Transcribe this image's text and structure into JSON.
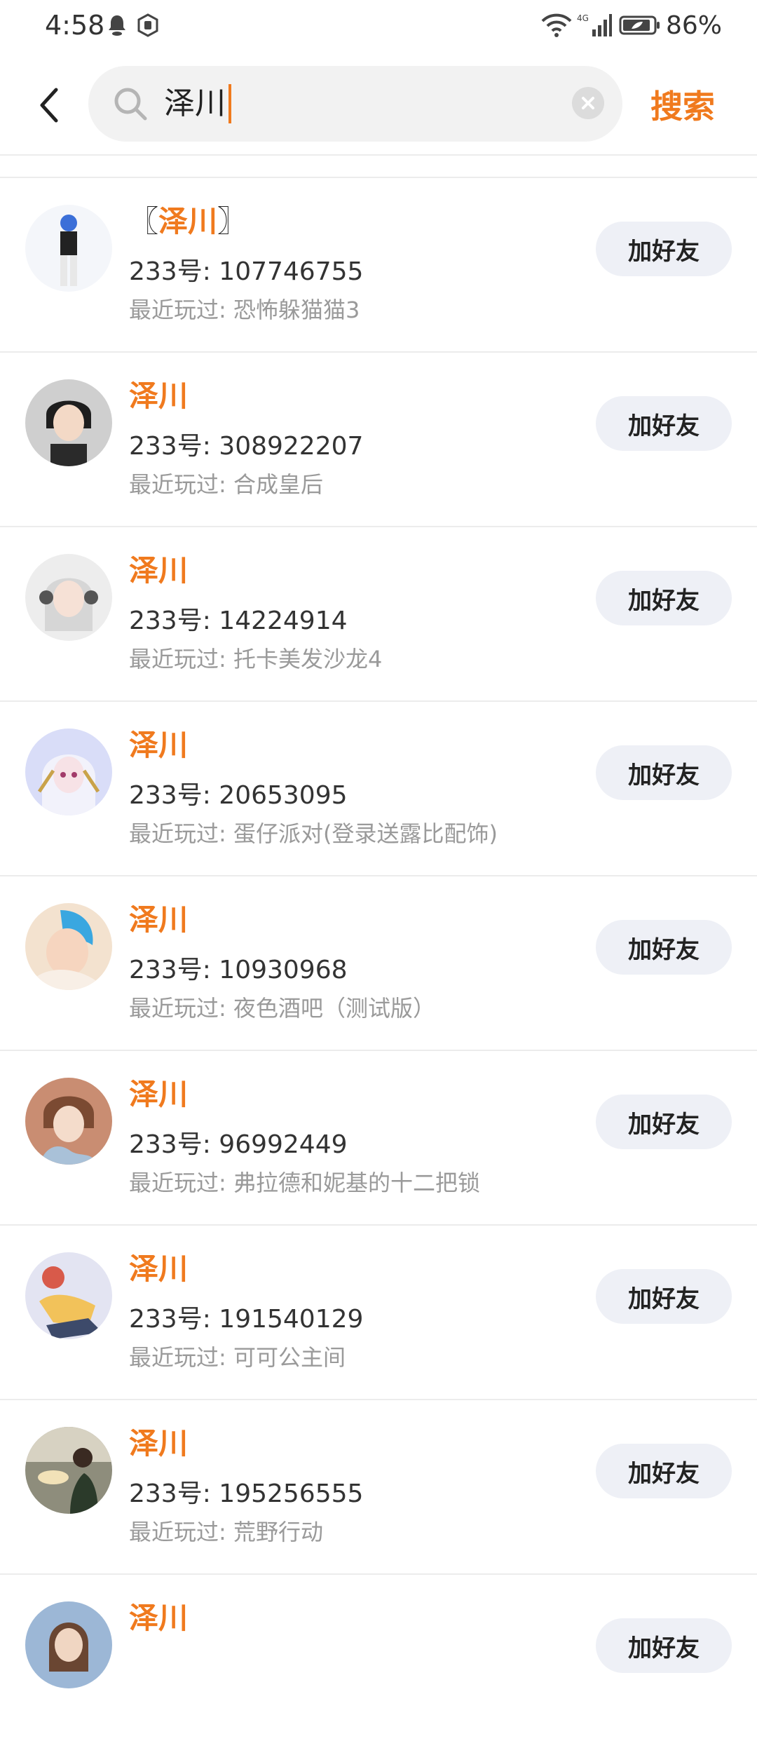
{
  "status_bar": {
    "time": "4:58",
    "battery_percent": "86%",
    "network": "4G"
  },
  "header": {
    "back_icon": "chevron-left-icon",
    "search_value": "泽川",
    "search_button": "搜索",
    "clear_icon": "close-circle-icon"
  },
  "accent_color": "#f07a1e",
  "results": [
    {
      "name": "泽川",
      "bracketed": true,
      "uid": "233号: 107746755",
      "recent": "最近玩过: 恐怖躲猫猫3",
      "button": "加好友",
      "avatar_color": "#e9eef5"
    },
    {
      "name": "泽川",
      "uid": "233号: 308922207",
      "recent": "最近玩过: 合成皇后",
      "button": "加好友",
      "avatar_color": "#c9c9c9"
    },
    {
      "name": "泽川",
      "uid": "233号: 14224914",
      "recent": "最近玩过: 托卡美发沙龙4",
      "button": "加好友",
      "avatar_color": "#e3e3e3"
    },
    {
      "name": "泽川",
      "uid": "233号: 20653095",
      "recent": "最近玩过: 蛋仔派对(登录送露比配饰)",
      "button": "加好友",
      "avatar_color": "#cdd3f5"
    },
    {
      "name": "泽川",
      "uid": "233号: 10930968",
      "recent": "最近玩过: 夜色酒吧（测试版）",
      "button": "加好友",
      "avatar_color": "#f2dcc4"
    },
    {
      "name": "泽川",
      "uid": "233号: 96992449",
      "recent": "最近玩过: 弗拉德和妮基的十二把锁",
      "button": "加好友",
      "avatar_color": "#d8a98d"
    },
    {
      "name": "泽川",
      "uid": "233号: 191540129",
      "recent": "最近玩过: 可可公主间",
      "button": "加好友",
      "avatar_color": "#dfe0f0"
    },
    {
      "name": "泽川",
      "uid": "233号: 195256555",
      "recent": "最近玩过: 荒野行动",
      "button": "加好友",
      "avatar_color": "#8a8a78"
    },
    {
      "name": "泽川",
      "uid": "",
      "recent": "",
      "button": "加好友",
      "avatar_color": "#9cb7d6"
    }
  ]
}
